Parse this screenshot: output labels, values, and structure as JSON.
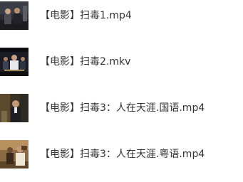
{
  "files": [
    {
      "name": "【电影】扫毒1.mp4",
      "thumbnail": "video-thumbnail"
    },
    {
      "name": "【电影】扫毒2.mkv",
      "thumbnail": "video-thumbnail"
    },
    {
      "name": "【电影】扫毒3：人在天涯.国语.mp4",
      "thumbnail": "video-thumbnail"
    },
    {
      "name": "【电影】扫毒3：人在天涯.粤语.mp4",
      "thumbnail": "video-thumbnail"
    }
  ]
}
